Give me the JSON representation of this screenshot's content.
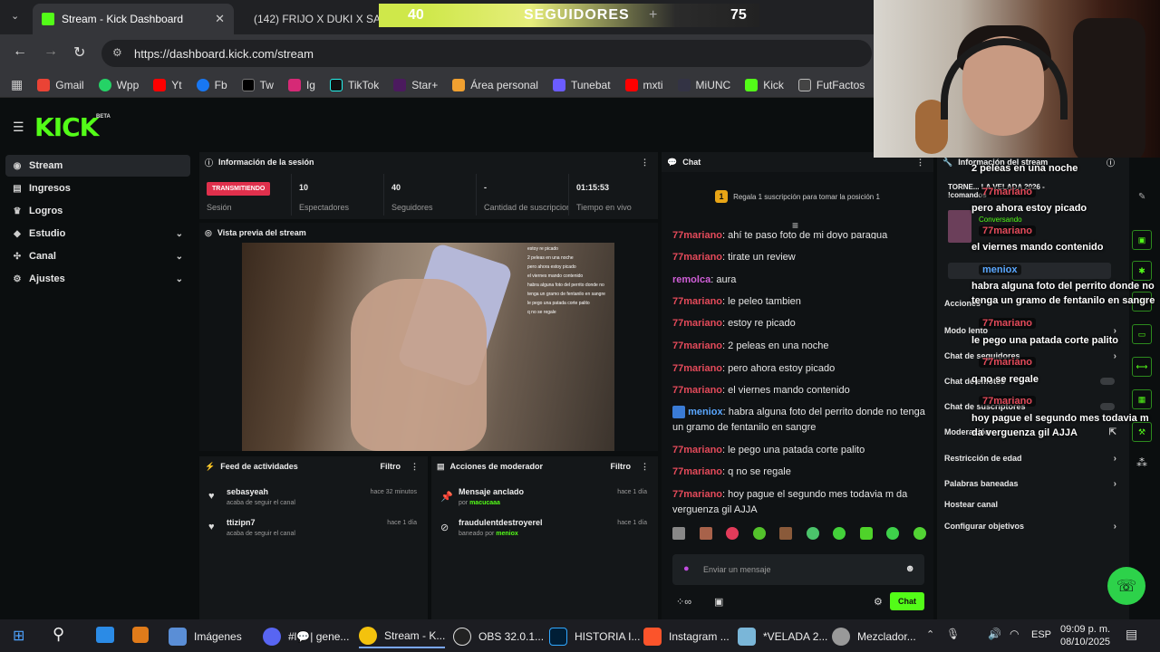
{
  "browser": {
    "tabs": [
      {
        "title": "Stream - Kick Dashboard"
      },
      {
        "title": "(142) FRIJO X DUKI X SAN"
      }
    ],
    "url": "https://dashboard.kick.com/stream",
    "bookmarks": [
      "Gmail",
      "Wpp",
      "Yt",
      "Fb",
      "Tw",
      "Ig",
      "TikTok",
      "Star+",
      "Área personal",
      "Tunebat",
      "mxti",
      "MiUNC",
      "Kick",
      "FutFactos"
    ]
  },
  "overlay_banner": {
    "current": "40",
    "label": "SEGUIDORES",
    "plus": "+",
    "goal": "75"
  },
  "kick": {
    "logo": "KICK",
    "beta": "BETA"
  },
  "sidebar": {
    "items": [
      {
        "label": "Stream"
      },
      {
        "label": "Ingresos"
      },
      {
        "label": "Logros"
      },
      {
        "label": "Estudio"
      },
      {
        "label": "Canal"
      },
      {
        "label": "Ajustes"
      }
    ]
  },
  "session": {
    "title": "Información de la sesión",
    "live_badge": "TRANSMITIENDO",
    "session_label": "Sesión",
    "stats": [
      {
        "value": "10",
        "label": "Espectadores"
      },
      {
        "value": "40",
        "label": "Seguidores"
      },
      {
        "value": "-",
        "label": "Cantidad de suscripciones"
      },
      {
        "value": "01:15:53",
        "label": "Tiempo en vivo"
      }
    ]
  },
  "preview": {
    "title": "Vista previa del stream",
    "mini_chat": [
      "estoy re picado",
      "2 peleas en una noche",
      "pero ahora estoy picado",
      "el viernes mando contenido",
      "habra alguna foto del perrito donde no tenga un gramo de fentanilo en sangre",
      "le pego una patada corte palito",
      "q no se regale"
    ]
  },
  "feed": {
    "title": "Feed de actividades",
    "filter": "Filtro",
    "rows": [
      {
        "who": "sebasyeah",
        "sub": "acaba de seguir el canal",
        "time": "hace 32 minutos"
      },
      {
        "who": "ttizipn7",
        "sub": "acaba de seguir el canal",
        "time": "hace 1 día"
      }
    ]
  },
  "modacts": {
    "title": "Acciones de moderador",
    "filter": "Filtro",
    "rows": [
      {
        "who": "Mensaje anclado",
        "sub_prefix": "por",
        "sub_user": "macucaaa",
        "time": "hace 1 día"
      },
      {
        "who": "fraudulentdestroyerel",
        "sub_prefix": "baneado por",
        "sub_user": "meniox",
        "time": "hace 1 día"
      }
    ]
  },
  "chat": {
    "title": "Chat",
    "pin_badge": "1",
    "pin_text": "Regala 1 suscripción para tomar la posición 1",
    "messages": [
      {
        "user": "77mariano",
        "text": "ahí te paso foto de mi doyo paragua"
      },
      {
        "user": "77mariano",
        "text": "tirate un review"
      },
      {
        "user": "remolca",
        "text": "aura"
      },
      {
        "user": "77mariano",
        "text": "le peleo tambien"
      },
      {
        "user": "77mariano",
        "text": "estoy re picado"
      },
      {
        "user": "77mariano",
        "text": "2 peleas en una noche"
      },
      {
        "user": "77mariano",
        "text": "pero ahora estoy picado"
      },
      {
        "user": "77mariano",
        "text": "el viernes mando contenido"
      },
      {
        "user": "meniox",
        "text": "habra alguna foto del perrito donde no tenga un gramo de fentanilo en sangre"
      },
      {
        "user": "77mariano",
        "text": "le pego una patada corte palito"
      },
      {
        "user": "77mariano",
        "text": "q no se regale"
      },
      {
        "user": "77mariano",
        "text": "hoy pague el segundo mes todavia m da verguenza gil AJJA"
      }
    ],
    "input_placeholder": "Enviar un mensaje",
    "send_label": "Chat"
  },
  "rightpanel": {
    "header": "Información del stream",
    "title_preview": "TORNE... LA VELADA 2026 - !comandos",
    "subtitle": "Conversando",
    "rows": [
      "Acciones",
      "Modo lento",
      "Chat de seguidores",
      "Chat de emotes",
      "Chat de suscriptores",
      "Moderación",
      "Restricción de edad",
      "Palabras baneadas",
      "Hostear canal",
      "Configurar objetivos"
    ]
  },
  "overlay_chat": [
    {
      "name": "",
      "text": "2 peleas en una noche"
    },
    {
      "name": "77mariano",
      "text": "pero ahora estoy picado"
    },
    {
      "name": "77mariano",
      "text": "el viernes mando contenido"
    },
    {
      "name": "meniox",
      "text": "habra alguna foto del perrito donde no tenga un gramo de fentanilo en sangre"
    },
    {
      "name": "77mariano",
      "text": "le pego una patada corte palito"
    },
    {
      "name": "77mariano",
      "text": "q no se regale"
    },
    {
      "name": "77mariano",
      "text": "hoy pague el segundo mes todavia m da verguenza gil AJJA"
    }
  ],
  "taskbar": {
    "items": [
      "Imágenes",
      "#l💬| gene...",
      "Stream - K...",
      "OBS 32.0.1...",
      "HISTORIA I...",
      "Instagram ...",
      "*VELADA 2...",
      "Mezclador..."
    ],
    "lang": "ESP",
    "time": "09:09 p. m.",
    "date": "08/10/2025"
  },
  "colors": {
    "kick_green": "#53fc18",
    "live_red": "#e0304c",
    "username_red": "#e34a5a"
  }
}
